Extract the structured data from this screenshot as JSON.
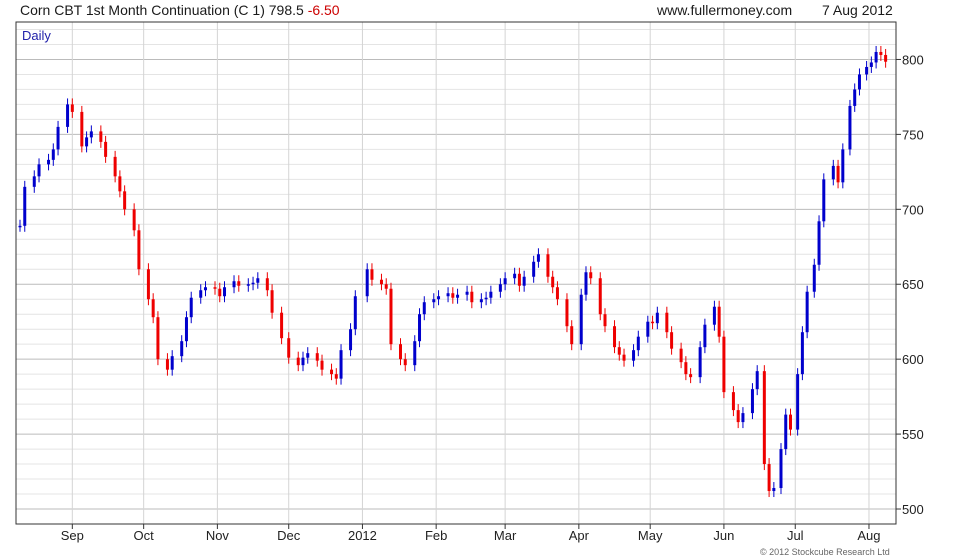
{
  "header": {
    "instrument": "Corn CBT 1st Month Continuation (C 1)",
    "last": "798.5",
    "change": "-6.50",
    "site": "www.fullermoney.com",
    "date": "7 Aug 2012"
  },
  "colors": {
    "up": "#0000cc",
    "down": "#ee0000",
    "grid": "#cccccc",
    "frame": "#333333"
  },
  "chart_data": {
    "type": "ohlc-candlestick",
    "interval_label": "Daily",
    "copyright": "© 2012 Stockcube Research Ltd",
    "y_axis": {
      "ticks": [
        500,
        550,
        600,
        650,
        700,
        750,
        800
      ],
      "range": [
        490,
        825
      ],
      "position": "right"
    },
    "x_axis": {
      "ticks": [
        {
          "label": "Sep",
          "date": "2011-09-01"
        },
        {
          "label": "Oct",
          "date": "2011-10-01"
        },
        {
          "label": "Nov",
          "date": "2011-11-01"
        },
        {
          "label": "Dec",
          "date": "2011-12-01"
        },
        {
          "label": "2012",
          "date": "2012-01-01"
        },
        {
          "label": "Feb",
          "date": "2012-02-01"
        },
        {
          "label": "Mar",
          "date": "2012-03-01"
        },
        {
          "label": "Apr",
          "date": "2012-04-01"
        },
        {
          "label": "May",
          "date": "2012-05-01"
        },
        {
          "label": "Jun",
          "date": "2012-06-01"
        },
        {
          "label": "Jul",
          "date": "2012-07-01"
        },
        {
          "label": "Aug",
          "date": "2012-08-01"
        }
      ],
      "range": [
        "2011-08-10",
        "2012-08-09"
      ]
    },
    "grid": true,
    "series": [
      {
        "values": [
          [
            "2011-08-10",
            689
          ],
          [
            "2011-08-12",
            715
          ],
          [
            "2011-08-16",
            722
          ],
          [
            "2011-08-18",
            730
          ],
          [
            "2011-08-22",
            733
          ],
          [
            "2011-08-24",
            740
          ],
          [
            "2011-08-26",
            755
          ],
          [
            "2011-08-30",
            770
          ],
          [
            "2011-09-01",
            765
          ],
          [
            "2011-09-05",
            742
          ],
          [
            "2011-09-07",
            748
          ],
          [
            "2011-09-09",
            752
          ],
          [
            "2011-09-13",
            745
          ],
          [
            "2011-09-15",
            735
          ],
          [
            "2011-09-19",
            722
          ],
          [
            "2011-09-21",
            712
          ],
          [
            "2011-09-23",
            700
          ],
          [
            "2011-09-27",
            686
          ],
          [
            "2011-09-29",
            660
          ],
          [
            "2011-10-03",
            640
          ],
          [
            "2011-10-05",
            628
          ],
          [
            "2011-10-07",
            600
          ],
          [
            "2011-10-11",
            593
          ],
          [
            "2011-10-13",
            602
          ],
          [
            "2011-10-17",
            612
          ],
          [
            "2011-10-19",
            628
          ],
          [
            "2011-10-21",
            641
          ],
          [
            "2011-10-25",
            646
          ],
          [
            "2011-10-27",
            648
          ],
          [
            "2011-10-31",
            647
          ],
          [
            "2011-11-02",
            642
          ],
          [
            "2011-11-04",
            648
          ],
          [
            "2011-11-08",
            652
          ],
          [
            "2011-11-10",
            649
          ],
          [
            "2011-11-14",
            650
          ],
          [
            "2011-11-16",
            651
          ],
          [
            "2011-11-18",
            654
          ],
          [
            "2011-11-22",
            646
          ],
          [
            "2011-11-24",
            631
          ],
          [
            "2011-11-28",
            614
          ],
          [
            "2011-12-01",
            601
          ],
          [
            "2011-12-05",
            596
          ],
          [
            "2011-12-07",
            601
          ],
          [
            "2011-12-09",
            604
          ],
          [
            "2011-12-13",
            599
          ],
          [
            "2011-12-15",
            593
          ],
          [
            "2011-12-19",
            590
          ],
          [
            "2011-12-21",
            587
          ],
          [
            "2011-12-23",
            606
          ],
          [
            "2011-12-27",
            620
          ],
          [
            "2011-12-29",
            642
          ],
          [
            "2012-01-03",
            660
          ],
          [
            "2012-01-05",
            653
          ],
          [
            "2012-01-09",
            650
          ],
          [
            "2012-01-11",
            647
          ],
          [
            "2012-01-13",
            610
          ],
          [
            "2012-01-17",
            600
          ],
          [
            "2012-01-19",
            596
          ],
          [
            "2012-01-23",
            612
          ],
          [
            "2012-01-25",
            630
          ],
          [
            "2012-01-27",
            638
          ],
          [
            "2012-01-31",
            640
          ],
          [
            "2012-02-02",
            642
          ],
          [
            "2012-02-06",
            644
          ],
          [
            "2012-02-08",
            641
          ],
          [
            "2012-02-10",
            643
          ],
          [
            "2012-02-14",
            645
          ],
          [
            "2012-02-16",
            638
          ],
          [
            "2012-02-20",
            640
          ],
          [
            "2012-02-22",
            641
          ],
          [
            "2012-02-24",
            645
          ],
          [
            "2012-02-28",
            650
          ],
          [
            "2012-03-01",
            654
          ],
          [
            "2012-03-05",
            657
          ],
          [
            "2012-03-07",
            649
          ],
          [
            "2012-03-09",
            655
          ],
          [
            "2012-03-13",
            665
          ],
          [
            "2012-03-15",
            670
          ],
          [
            "2012-03-19",
            655
          ],
          [
            "2012-03-21",
            648
          ],
          [
            "2012-03-23",
            640
          ],
          [
            "2012-03-27",
            622
          ],
          [
            "2012-03-29",
            610
          ],
          [
            "2012-04-02",
            643
          ],
          [
            "2012-04-04",
            658
          ],
          [
            "2012-04-06",
            654
          ],
          [
            "2012-04-10",
            630
          ],
          [
            "2012-04-12",
            622
          ],
          [
            "2012-04-16",
            608
          ],
          [
            "2012-04-18",
            603
          ],
          [
            "2012-04-20",
            599
          ],
          [
            "2012-04-24",
            606
          ],
          [
            "2012-04-26",
            615
          ],
          [
            "2012-04-30",
            625
          ],
          [
            "2012-05-02",
            624
          ],
          [
            "2012-05-04",
            631
          ],
          [
            "2012-05-08",
            618
          ],
          [
            "2012-05-10",
            607
          ],
          [
            "2012-05-14",
            598
          ],
          [
            "2012-05-16",
            590
          ],
          [
            "2012-05-18",
            588
          ],
          [
            "2012-05-22",
            608
          ],
          [
            "2012-05-24",
            623
          ],
          [
            "2012-05-28",
            635
          ],
          [
            "2012-05-30",
            615
          ],
          [
            "2012-06-01",
            578
          ],
          [
            "2012-06-05",
            566
          ],
          [
            "2012-06-07",
            558
          ],
          [
            "2012-06-09",
            564
          ],
          [
            "2012-06-13",
            580
          ],
          [
            "2012-06-15",
            592
          ],
          [
            "2012-06-18",
            530
          ],
          [
            "2012-06-20",
            512
          ],
          [
            "2012-06-22",
            514
          ],
          [
            "2012-06-25",
            540
          ],
          [
            "2012-06-27",
            563
          ],
          [
            "2012-06-29",
            553
          ],
          [
            "2012-07-02",
            590
          ],
          [
            "2012-07-04",
            618
          ],
          [
            "2012-07-06",
            645
          ],
          [
            "2012-07-09",
            663
          ],
          [
            "2012-07-11",
            692
          ],
          [
            "2012-07-13",
            720
          ],
          [
            "2012-07-17",
            729
          ],
          [
            "2012-07-19",
            718
          ],
          [
            "2012-07-21",
            740
          ],
          [
            "2012-07-24",
            769
          ],
          [
            "2012-07-26",
            780
          ],
          [
            "2012-07-28",
            790
          ],
          [
            "2012-07-31",
            795
          ],
          [
            "2012-08-02",
            798
          ],
          [
            "2012-08-04",
            805
          ],
          [
            "2012-08-06",
            803
          ],
          [
            "2012-08-08",
            798.5
          ]
        ]
      }
    ]
  }
}
